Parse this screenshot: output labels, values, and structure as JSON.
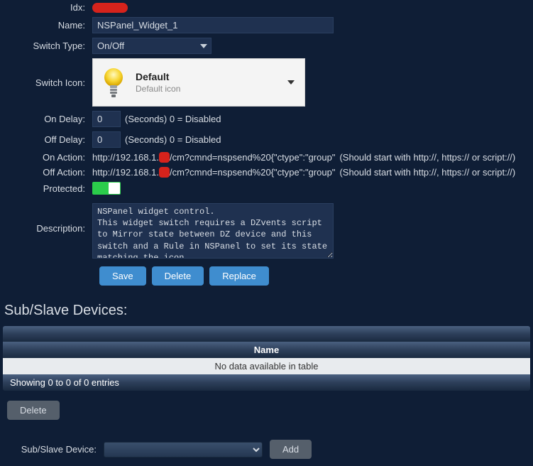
{
  "form": {
    "idx_label": "Idx:",
    "name_label": "Name:",
    "name_value": "NSPanel_Widget_1",
    "switch_type_label": "Switch Type:",
    "switch_type_value": "On/Off",
    "switch_icon_label": "Switch Icon:",
    "switch_icon_title": "Default",
    "switch_icon_sub": "Default icon",
    "on_delay_label": "On Delay:",
    "on_delay_value": "0",
    "off_delay_label": "Off Delay:",
    "off_delay_value": "0",
    "delay_hint": "(Seconds) 0 = Disabled",
    "on_action_label": "On Action:",
    "on_action_prefix": "http://192.168.1.",
    "on_action_suffix": "/cm?cmnd=nspsend%20{\"ctype\":\"group\"",
    "off_action_label": "Off Action:",
    "off_action_prefix": "http://192.168.1.",
    "off_action_suffix": "/cm?cmnd=nspsend%20{\"ctype\":\"group\"",
    "action_hint": "(Should start with http://, https:// or script://)",
    "protected_label": "Protected:",
    "protected_value": true,
    "description_label": "Description:",
    "description_value": "NSPanel widget control.\nThis widget switch requires a DZvents script to Mirror state between DZ device and this switch and a Rule in NSPanel to set its state matching the icon."
  },
  "buttons": {
    "save": "Save",
    "delete": "Delete",
    "replace": "Replace",
    "delete2": "Delete",
    "add": "Add"
  },
  "sub_table": {
    "heading": "Sub/Slave Devices:",
    "col_name": "Name",
    "no_data": "No data available in table",
    "info": "Showing 0 to 0 of 0 entries"
  },
  "add_section": {
    "label": "Sub/Slave Device:"
  }
}
